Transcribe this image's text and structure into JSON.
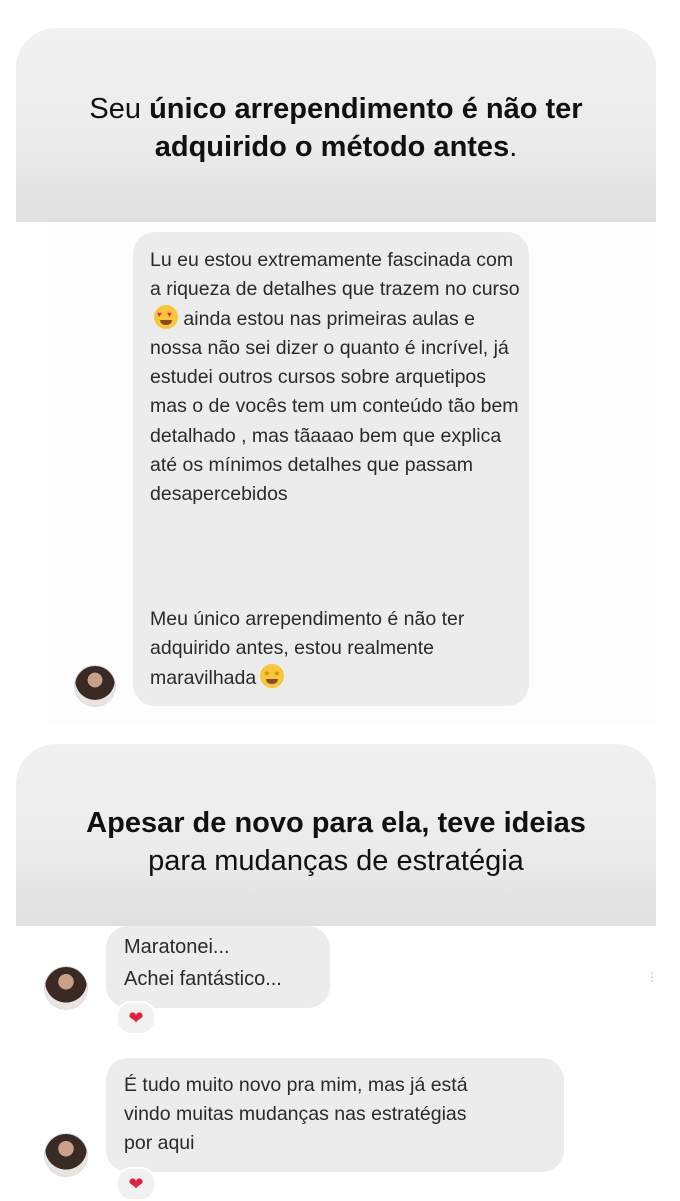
{
  "section1": {
    "headline_pre": "Seu ",
    "headline_bold_1": "único arrependimento é não ter",
    "headline_bold_2": "adquirido o método antes",
    "headline_post": "."
  },
  "message1": {
    "paragraph1": "Lu eu estou extremamente fascinada com a riqueza de detalhes que trazem no curso",
    "paragraph1_cont": "ainda estou nas primeiras aulas e nossa não sei dizer o quanto é incrível, já estudei outros cursos sobre arquetipos mas o de vocês tem um conteúdo tão bem detalhado , mas tãaaao bem que explica até os mínimos detalhes que passam desapercebidos",
    "paragraph2": "Meu único arrependimento é não ter adquirido antes, estou realmente maravilhada",
    "emoji1": "heart-eyes-emoji",
    "emoji2": "star-struck-emoji"
  },
  "section2": {
    "headline_bold": "Apesar de novo para ela, teve ideias",
    "headline_regular": "para mudanças de estratégia"
  },
  "message2": {
    "line1": "Maratonei...",
    "line2": "Achei fantástico...",
    "reaction": "❤"
  },
  "message3": {
    "line1": "É tudo muito novo pra mim, mas já está",
    "line2": "vindo muitas mudanças nas estratégias",
    "line3": "por aqui",
    "reaction": "❤"
  },
  "colors": {
    "card_bg": "#ececec",
    "bubble_bg": "#ececec",
    "heart": "#e0223c"
  }
}
